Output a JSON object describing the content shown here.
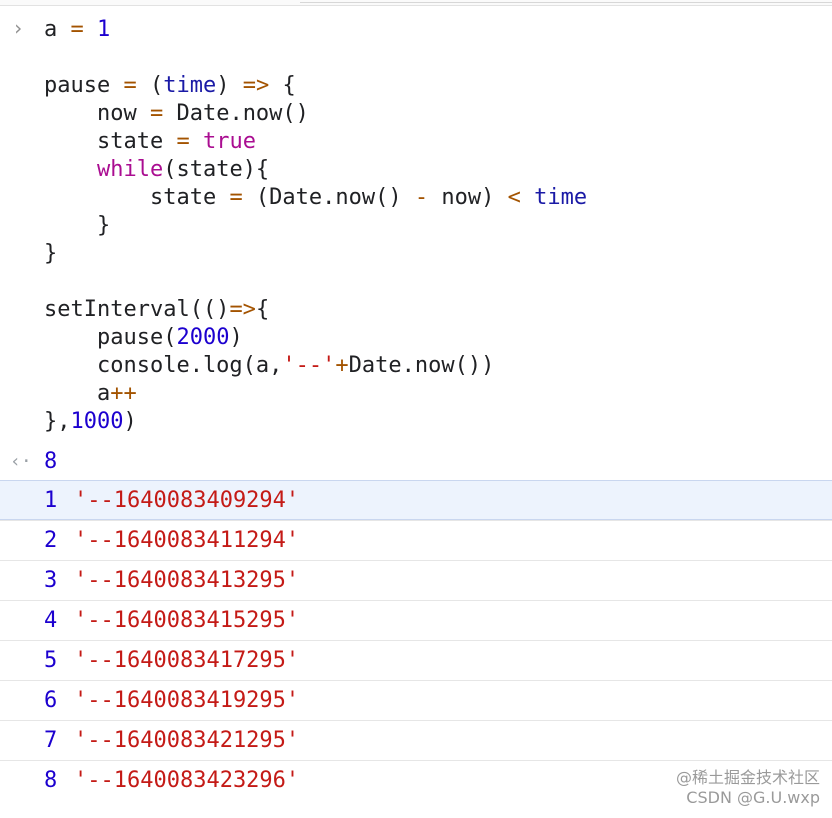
{
  "console": {
    "prompt_glyph": "›",
    "result_glyph": "‹·",
    "input_lines": [
      [
        {
          "t": "a",
          "c": "id"
        },
        {
          "t": " ",
          "c": "id"
        },
        {
          "t": "=",
          "c": "op"
        },
        {
          "t": " ",
          "c": "id"
        },
        {
          "t": "1",
          "c": "num"
        }
      ],
      [],
      [
        {
          "t": "pause",
          "c": "id"
        },
        {
          "t": " ",
          "c": "id"
        },
        {
          "t": "=",
          "c": "op"
        },
        {
          "t": " (",
          "c": "id"
        },
        {
          "t": "time",
          "c": "blue"
        },
        {
          "t": ") ",
          "c": "id"
        },
        {
          "t": "=>",
          "c": "op"
        },
        {
          "t": " {",
          "c": "id"
        }
      ],
      [
        {
          "t": "    now ",
          "c": "id"
        },
        {
          "t": "=",
          "c": "op"
        },
        {
          "t": " Date.now()",
          "c": "id"
        }
      ],
      [
        {
          "t": "    state ",
          "c": "id"
        },
        {
          "t": "=",
          "c": "op"
        },
        {
          "t": " ",
          "c": "id"
        },
        {
          "t": "true",
          "c": "kw"
        }
      ],
      [
        {
          "t": "    ",
          "c": "id"
        },
        {
          "t": "while",
          "c": "kw"
        },
        {
          "t": "(state){",
          "c": "id"
        }
      ],
      [
        {
          "t": "        state ",
          "c": "id"
        },
        {
          "t": "=",
          "c": "op"
        },
        {
          "t": " (Date.now() ",
          "c": "id"
        },
        {
          "t": "-",
          "c": "op"
        },
        {
          "t": " now) ",
          "c": "id"
        },
        {
          "t": "<",
          "c": "op"
        },
        {
          "t": " ",
          "c": "id"
        },
        {
          "t": "time",
          "c": "blue"
        }
      ],
      [
        {
          "t": "    }",
          "c": "id"
        }
      ],
      [
        {
          "t": "}",
          "c": "id"
        }
      ],
      [],
      [
        {
          "t": "setInterval(()",
          "c": "id"
        },
        {
          "t": "=>",
          "c": "op"
        },
        {
          "t": "{",
          "c": "id"
        }
      ],
      [
        {
          "t": "    pause(",
          "c": "id"
        },
        {
          "t": "2000",
          "c": "num"
        },
        {
          "t": ")",
          "c": "id"
        }
      ],
      [
        {
          "t": "    console.log(a,",
          "c": "id"
        },
        {
          "t": "'--'",
          "c": "str"
        },
        {
          "t": "+",
          "c": "op"
        },
        {
          "t": "Date.now())",
          "c": "id"
        }
      ],
      [
        {
          "t": "    a",
          "c": "id"
        },
        {
          "t": "++",
          "c": "op"
        }
      ],
      [
        {
          "t": "},",
          "c": "id"
        },
        {
          "t": "1000",
          "c": "num"
        },
        {
          "t": ")",
          "c": "id"
        }
      ]
    ],
    "result": "8",
    "logs": [
      {
        "num": "1",
        "str": "'--1640083409294'"
      },
      {
        "num": "2",
        "str": "'--1640083411294'"
      },
      {
        "num": "3",
        "str": "'--1640083413295'"
      },
      {
        "num": "4",
        "str": "'--1640083415295'"
      },
      {
        "num": "5",
        "str": "'--1640083417295'"
      },
      {
        "num": "6",
        "str": "'--1640083419295'"
      },
      {
        "num": "7",
        "str": "'--1640083421295'"
      },
      {
        "num": "8",
        "str": "'--1640083423296'"
      }
    ],
    "highlighted_log_index": 0
  },
  "watermark": {
    "line1": "@稀土掘金技术社区",
    "line2": "CSDN @G.U.wxp"
  },
  "colors": {
    "keyword": "#aa0d91",
    "number": "#1c00cf",
    "operator": "#a35300",
    "string": "#c41a16",
    "identifier": "#202124",
    "highlight_row": "#edf3fd"
  }
}
